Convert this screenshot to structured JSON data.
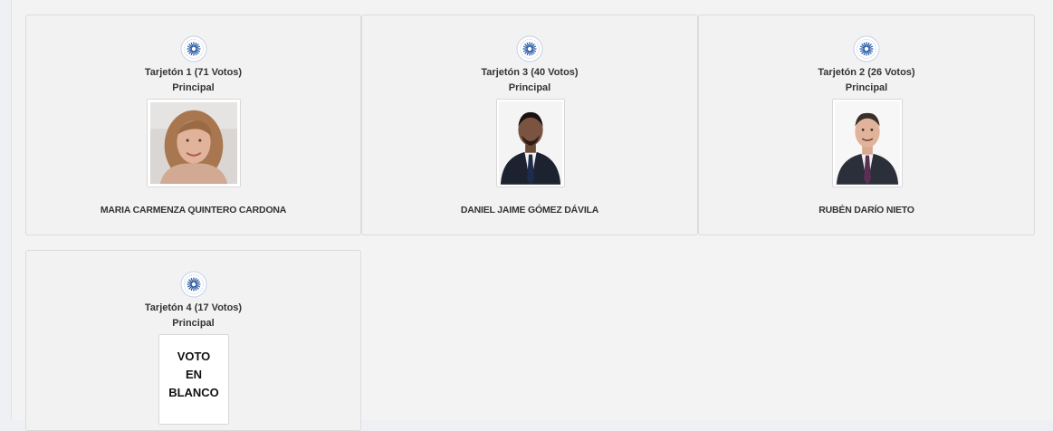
{
  "cards": [
    {
      "ballot": "Tarjetón 1 (71 Votos)",
      "role": "Principal",
      "candidate": "MARIA CARMENZA QUINTERO CARDONA"
    },
    {
      "ballot": "Tarjetón 3 (40 Votos)",
      "role": "Principal",
      "candidate": "DANIEL JAIME GÓMEZ DÁVILA"
    },
    {
      "ballot": "Tarjetón 2 (26 Votos)",
      "role": "Principal",
      "candidate": "RUBÉN DARÍO NIETO"
    },
    {
      "ballot": "Tarjetón 4 (17 Votos)",
      "role": "Principal",
      "blank_vote": [
        "VOTO",
        "EN",
        "BLANCO"
      ]
    }
  ],
  "logo_icon": "university-seal-icon",
  "colors": {
    "accent_blue": "#2f5fa8",
    "text": "#333333",
    "card_bg": "#f2f2f2"
  }
}
